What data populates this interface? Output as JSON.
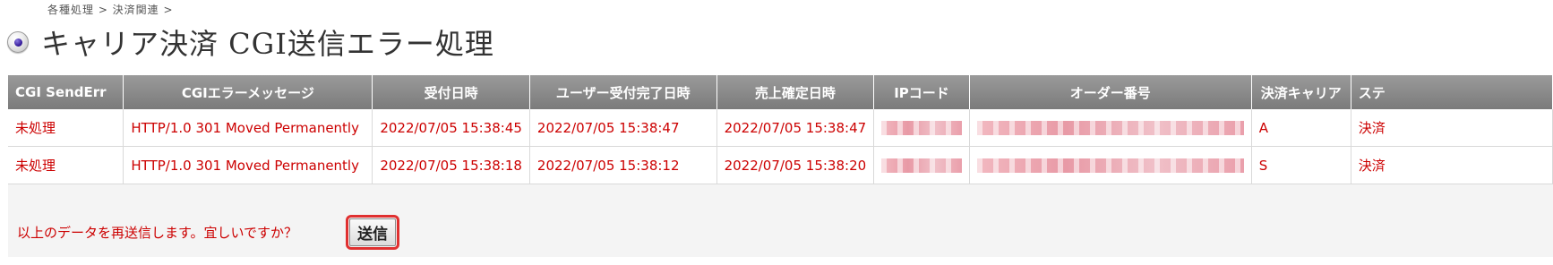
{
  "breadcrumb": "各種処理 > 決済関連 >",
  "page_title": "キャリア決済 CGI送信エラー処理",
  "table": {
    "columns": [
      "CGI SendErr",
      "CGIエラーメッセージ",
      "受付日時",
      "ユーザー受付完了日時",
      "売上確定日時",
      "IPコード",
      "オーダー番号",
      "決済キャリア",
      "ステ"
    ],
    "rows": [
      {
        "status": "未処理",
        "message": "HTTP/1.0 301 Moved Permanently",
        "received": "2022/07/05 15:38:45",
        "user_completed": "2022/07/05 15:38:47",
        "sales_confirmed": "2022/07/05 15:38:47",
        "carrier": "A",
        "state": "決済"
      },
      {
        "status": "未処理",
        "message": "HTTP/1.0 301 Moved Permanently",
        "received": "2022/07/05 15:38:18",
        "user_completed": "2022/07/05 15:38:12",
        "sales_confirmed": "2022/07/05 15:38:20",
        "carrier": "S",
        "state": "決済"
      }
    ]
  },
  "confirm_message": "以上のデータを再送信します。宜しいですか？",
  "send_label": "送信",
  "colors": {
    "header_bg": "#8a8a8a",
    "error_text": "#cc0000",
    "highlight": "#e03030"
  }
}
